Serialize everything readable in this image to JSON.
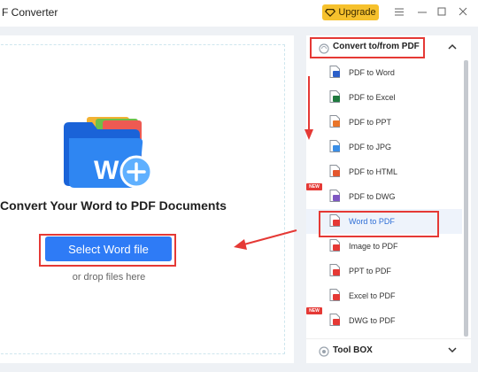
{
  "window": {
    "title": "F Converter",
    "upgrade_label": "Upgrade",
    "controls": [
      "menu-icon",
      "minimize-icon",
      "maximize-icon",
      "close-icon"
    ]
  },
  "main": {
    "heading": "Convert Your Word to PDF Documents",
    "select_button": "Select Word file",
    "drop_hint": "or drop files here",
    "folder_letter": "W"
  },
  "sidebar": {
    "section_title": "Convert to/from PDF",
    "items": [
      {
        "label": "PDF to Word",
        "icon": "word-file-icon",
        "color": "#2b5fc9",
        "badge": ""
      },
      {
        "label": "PDF to Excel",
        "icon": "excel-file-icon",
        "color": "#1f7a3f",
        "badge": ""
      },
      {
        "label": "PDF to PPT",
        "icon": "ppt-file-icon",
        "color": "#e9752a",
        "badge": ""
      },
      {
        "label": "PDF to JPG",
        "icon": "jpg-file-icon",
        "color": "#3a8ee6",
        "badge": ""
      },
      {
        "label": "PDF to HTML",
        "icon": "html-file-icon",
        "color": "#e4572e",
        "badge": ""
      },
      {
        "label": "PDF to DWG",
        "icon": "dwg-file-icon",
        "color": "#7e57c2",
        "badge": "NEW"
      },
      {
        "label": "Word to PDF",
        "icon": "pdf-file-icon",
        "color": "#e53935",
        "badge": ""
      },
      {
        "label": "Image to PDF",
        "icon": "pdf-file-icon",
        "color": "#e53935",
        "badge": ""
      },
      {
        "label": "PPT to PDF",
        "icon": "pdf-file-icon",
        "color": "#e53935",
        "badge": ""
      },
      {
        "label": "Excel to PDF",
        "icon": "pdf-file-icon",
        "color": "#e53935",
        "badge": ""
      },
      {
        "label": "DWG to PDF",
        "icon": "pdf-file-icon",
        "color": "#e53935",
        "badge": "NEW"
      }
    ],
    "active_item": "Word to PDF",
    "toolbox_title": "Tool BOX"
  },
  "colors": {
    "accent": "#2e7bf6",
    "highlight_frame": "#e53935",
    "upgrade": "#f6c12d"
  }
}
